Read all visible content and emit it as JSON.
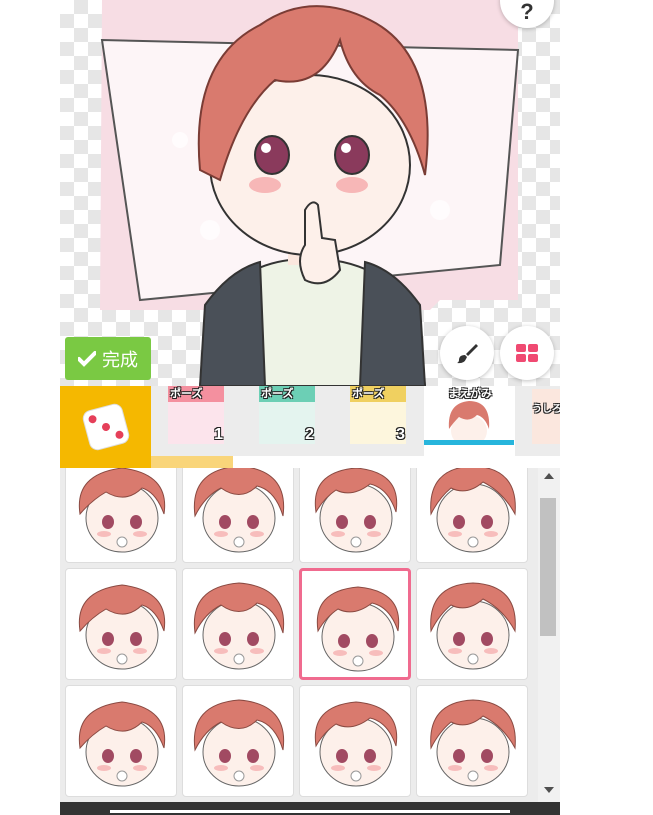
{
  "colors": {
    "accent_green": "#7ac943",
    "dice_bg": "#f5b800",
    "active_tab": "#27b5dc",
    "selected_border": "#f06b8f",
    "progress": "#f9d57a",
    "hair": "#d97a6e"
  },
  "preview": {
    "help_label": "?",
    "help_icon": "question-icon",
    "brush_icon": "brush-icon",
    "grid_icon": "grid-icon",
    "done_label": "完成",
    "done_icon": "check-icon"
  },
  "tabs": [
    {
      "label": "ポーズ",
      "number": "1"
    },
    {
      "label": "ポーズ",
      "number": "2"
    },
    {
      "label": "ポーズ",
      "number": "3"
    },
    {
      "label": "まえがみ",
      "number": ""
    },
    {
      "label": "うしろがみ",
      "number": ""
    }
  ],
  "active_tab_index": 3,
  "progress_fraction": 0.2,
  "grid": {
    "columns": 4,
    "rows": 3,
    "selected_index": 6
  }
}
